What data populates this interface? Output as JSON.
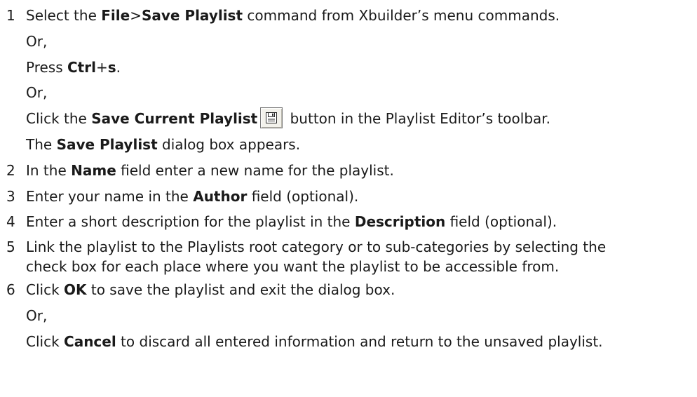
{
  "steps": [
    {
      "number": "1",
      "parts": {
        "t1": "Select the ",
        "b1": "File",
        "t2": ">",
        "b2": "Save Playlist",
        "t3": " command from Xbuilder’s menu commands."
      }
    },
    {
      "or": "Or,"
    },
    {
      "parts": {
        "t1": "Press ",
        "b1": "Ctrl",
        "t2": "+",
        "b2": "s",
        "t3": "."
      }
    },
    {
      "or": "Or,"
    },
    {
      "parts": {
        "t1": "Click the ",
        "b1": "Save Current Playlist",
        "t2": " button in the Playlist Editor’s toolbar."
      },
      "icon": "save-floppy-icon"
    },
    {
      "parts": {
        "t1": "The ",
        "b1": "Save Playlist",
        "t2": " dialog box appears."
      }
    },
    {
      "number": "2",
      "parts": {
        "t1": "In the ",
        "b1": "Name",
        "t2": " field enter a new name for the playlist."
      }
    },
    {
      "number": "3",
      "parts": {
        "t1": "Enter your name in the ",
        "b1": "Author",
        "t2": " field (optional)."
      }
    },
    {
      "number": "4",
      "parts": {
        "t1": "Enter a short description for the playlist in the ",
        "b1": "Description",
        "t2": " field (optional)."
      }
    },
    {
      "number": "5",
      "line1": "Link the playlist to the Playlists root category or to sub-categories by selecting the",
      "line2": "check box for each place where you want the playlist to be accessible from."
    },
    {
      "number": "6",
      "parts": {
        "t1": "Click ",
        "b1": "OK",
        "t2": " to save the playlist and exit the dialog box."
      }
    },
    {
      "or": "Or,"
    },
    {
      "parts": {
        "t1": "Click ",
        "b1": "Cancel",
        "t2": " to discard all entered information and return to the unsaved playlist."
      }
    }
  ]
}
